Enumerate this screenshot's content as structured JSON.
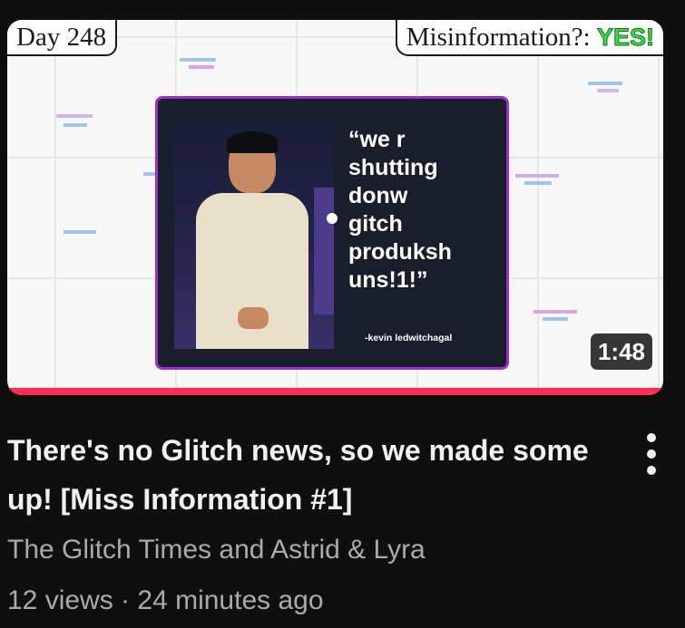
{
  "thumbnail": {
    "day_tag": "Day 248",
    "misinfo_label": "Misinformation?:",
    "misinfo_value": "YES!",
    "quote": "“we r\nshutting\ndonw\ngitch\nproduksh\nuns!1!”",
    "attribution": "-kevin ledwitchagal",
    "duration": "1:48",
    "accent_color": "#ff2d55",
    "frame_color": "#9b2ec9"
  },
  "video": {
    "title": "There's no Glitch news, so we made some up! [Miss Information #1]",
    "channel": "The Glitch Times and Astrid & Lyra",
    "views": "12 views",
    "separator": " · ",
    "age": "24 minutes ago"
  },
  "icons": {
    "menu": "more-vert-icon"
  }
}
